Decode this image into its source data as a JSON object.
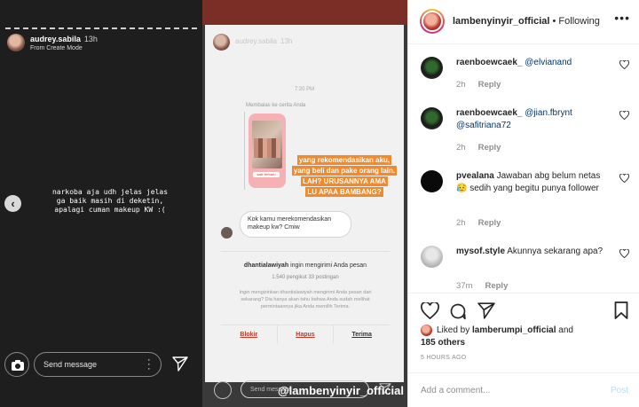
{
  "story": {
    "username": "audrey.sabila",
    "time": "13h",
    "mode": "From Create Mode",
    "text": "narkoba aja udh jelas jelas\nga baik masih di deketin,\napalagi cuman makeup KW :(",
    "message_placeholder": "Send message"
  },
  "dm": {
    "username": "audrey.sabila",
    "time": "13h",
    "clock": "7:20 PM",
    "replied_label": "Membalas ke cerita Anda",
    "thumb_tag": "sale terbaru",
    "orange_lines": [
      "yang rekomendasikan aku,",
      "yang beli dan pake orang lain.",
      "LAH? URUSANNYA AMA",
      "LU APAA BAMBANG?"
    ],
    "bubble_text": "Kok kamu merekomendasikan makeup kw? Cmiw",
    "request_user": "dhantialawiyah",
    "request_text": "ingin mengirimi Anda pesan",
    "request_stats": "1.540 pengikut 33 postingan",
    "request_desc": "Ingin mengizinkan dhantialawiyah mengirimi Anda pesan dari sekarang? Dia hanya akan tahu bahwa Anda sudah melihat permintaannya jika Anda memilih Terima.",
    "btn_block": "Blokir",
    "btn_delete": "Hapus",
    "btn_accept": "Terima",
    "message_placeholder": "Send message",
    "watermark": "@lambenyinyir_official"
  },
  "ig": {
    "header_user": "lambenyinyir_official",
    "header_sep": "•",
    "header_follow": "Following",
    "comments": [
      {
        "user": "raenboewcaek_",
        "text": "@elvianand",
        "time": "2h",
        "reply": "Reply"
      },
      {
        "user": "raenboewcaek_",
        "text": "@jian.fbrynt @safitriana72",
        "time": "2h",
        "reply": "Reply"
      },
      {
        "user": "pvealana",
        "text": "Jawaban abg belum netas 😥 sedih yang begitu punya follower",
        "time": "2h",
        "reply": "Reply"
      },
      {
        "user": "mysof.style",
        "text": "Akunnya sekarang apa?",
        "time": "37m",
        "reply": "Reply"
      }
    ],
    "liked_by_prefix": "Liked by",
    "liked_by_user": "lamberumpi_official",
    "liked_by_and": "and",
    "liked_others": "185 others",
    "posted": "5 HOURS AGO",
    "comment_placeholder": "Add a comment...",
    "post_label": "Post",
    "colors": {
      "accent": "#0095f6",
      "link": "#00376b",
      "muted": "#8e8e8e",
      "dm_highlight": "#f28a2b"
    }
  }
}
